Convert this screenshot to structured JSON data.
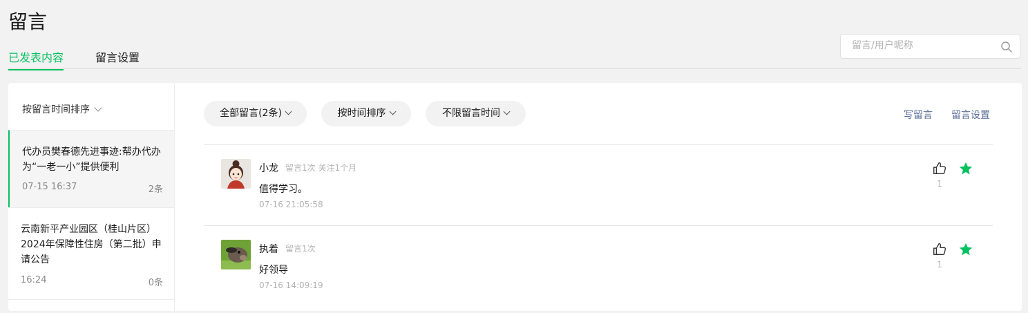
{
  "header": {
    "title": "留言"
  },
  "tabs": [
    {
      "label": "已发表内容"
    },
    {
      "label": "留言设置"
    }
  ],
  "search": {
    "placeholder": "留言/用户昵称",
    "value": ""
  },
  "left": {
    "sort_label": "按留言时间排序",
    "articles": [
      {
        "title": "代办员樊春德先进事迹:帮办代办为“一老一小”提供便利",
        "date": "07-15 16:37",
        "count": "2条"
      },
      {
        "title": "云南新平产业园区（桂山片区）2024年保障性住房（第二批）申请公告",
        "date": "16:24",
        "count": "0条"
      }
    ]
  },
  "toolbar": {
    "filters": [
      {
        "label": "全部留言(2条)"
      },
      {
        "label": "按时间排序"
      },
      {
        "label": "不限留言时间"
      }
    ],
    "write_label": "写留言",
    "settings_label": "留言设置"
  },
  "comments": [
    {
      "name": "小龙",
      "meta": "留言1次 关注1个月",
      "text": "值得学习。",
      "time": "07-16 21:05:58",
      "likes": "1",
      "avatar_icon": "cartoon-girl-avatar"
    },
    {
      "name": "执着",
      "meta": "留言1次",
      "text": "好领导",
      "time": "07-16 14:09:19",
      "likes": "1",
      "avatar_icon": "animal-photo-avatar"
    }
  ],
  "colors": {
    "accent": "#07c160",
    "link": "#576b95",
    "muted": "#b2b2b2",
    "background": "#f2f2f2"
  }
}
